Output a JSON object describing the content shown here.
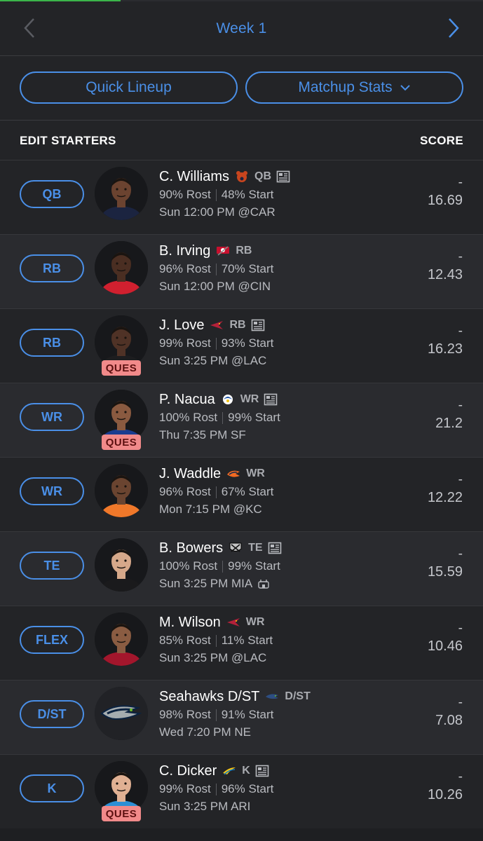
{
  "header": {
    "week_label": "Week 1",
    "quick_lineup_label": "Quick Lineup",
    "matchup_stats_label": "Matchup Stats"
  },
  "section": {
    "title": "EDIT STARTERS",
    "score_label": "SCORE"
  },
  "colors": {
    "accent": "#4a8fe7",
    "background": "#232427",
    "ques_badge": "#f18a8a",
    "progress": "#3bb54a"
  },
  "players": [
    {
      "slot": "QB",
      "name": "C. Williams",
      "team_logo": "bears-logo",
      "pos": "QB",
      "has_news": true,
      "rost": "90% Rost",
      "start": "48% Start",
      "game": "Sun 12:00 PM @CAR",
      "dash": "-",
      "score": "16.69",
      "ques": false,
      "jersey": "#1b2440",
      "skin": "#6b4330"
    },
    {
      "slot": "RB",
      "name": "B. Irving",
      "team_logo": "buccaneers-logo",
      "pos": "RB",
      "has_news": false,
      "rost": "96% Rost",
      "start": "70% Start",
      "game": "Sun 12:00 PM @CIN",
      "dash": "-",
      "score": "12.43",
      "ques": false,
      "jersey": "#d0202f",
      "skin": "#4a2e22"
    },
    {
      "slot": "RB",
      "name": "J. Love",
      "team_logo": "cardinals-logo",
      "pos": "RB",
      "has_news": true,
      "rost": "99% Rost",
      "start": "93% Start",
      "game": "Sun 3:25 PM @LAC",
      "dash": "-",
      "score": "16.23",
      "ques": true,
      "ques_label": "QUES",
      "jersey": "#1d1d1f",
      "skin": "#4f3226"
    },
    {
      "slot": "WR",
      "name": "P. Nacua",
      "team_logo": "rams-logo",
      "pos": "WR",
      "has_news": true,
      "rost": "100% Rost",
      "start": "99% Start",
      "game": "Thu 7:35 PM SF",
      "dash": "-",
      "score": "21.2",
      "ques": true,
      "ques_label": "QUES",
      "jersey": "#1a3c8f",
      "skin": "#8a5a40"
    },
    {
      "slot": "WR",
      "name": "J. Waddle",
      "team_logo": "broncos-logo",
      "pos": "WR",
      "has_news": false,
      "rost": "96% Rost",
      "start": "67% Start",
      "game": "Mon 7:15 PM @KC",
      "dash": "-",
      "score": "12.22",
      "ques": false,
      "jersey": "#f0782a",
      "skin": "#6a4430"
    },
    {
      "slot": "TE",
      "name": "B. Bowers",
      "team_logo": "raiders-logo",
      "pos": "TE",
      "has_news": true,
      "rost": "100% Rost",
      "start": "99% Start",
      "game": "Sun 3:25 PM MIA",
      "weather": "stadium-icon",
      "dash": "-",
      "score": "15.59",
      "ques": false,
      "jersey": "#1a1a1c",
      "skin": "#d6a88a"
    },
    {
      "slot": "FLEX",
      "name": "M. Wilson",
      "team_logo": "cardinals-logo",
      "pos": "WR",
      "has_news": false,
      "rost": "85% Rost",
      "start": "11% Start",
      "game": "Sun 3:25 PM @LAC",
      "dash": "-",
      "score": "10.46",
      "ques": false,
      "jersey": "#a3162c",
      "skin": "#8a5c42"
    },
    {
      "slot": "D/ST",
      "name": "Seahawks D/ST",
      "team_logo": "seahawks-logo",
      "pos": "D/ST",
      "has_news": false,
      "rost": "98% Rost",
      "start": "91% Start",
      "game": "Wed 7:20 PM NE",
      "dash": "-",
      "score": "7.08",
      "ques": false,
      "is_team": true
    },
    {
      "slot": "K",
      "name": "C. Dicker",
      "team_logo": "chargers-logo",
      "pos": "K",
      "has_news": true,
      "rost": "99% Rost",
      "start": "96% Start",
      "game": "Sun 3:25 PM ARI",
      "dash": "-",
      "score": "10.26",
      "ques": true,
      "ques_label": "QUES",
      "jersey": "#2d8fd5",
      "skin": "#e0b093"
    }
  ]
}
